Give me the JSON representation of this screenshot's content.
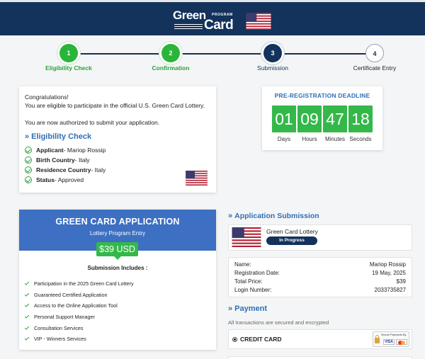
{
  "header": {
    "logo_word1": "Green",
    "logo_program": "PROGRAM",
    "logo_word2": "Card",
    "flag_icon": "us-flag-icon",
    "background_color": "#13325c"
  },
  "steps": [
    {
      "number": "1",
      "label": "Eligibility Check",
      "state": "done"
    },
    {
      "number": "2",
      "label": "Confirmation",
      "state": "done"
    },
    {
      "number": "3",
      "label": "Submission",
      "state": "active"
    },
    {
      "number": "4",
      "label": "Certificate Entry",
      "state": "todo"
    }
  ],
  "congrats": {
    "line1": "Congratulations!",
    "line2": "You are eligible to participate in the official U.S. Green Card Lottery.",
    "line3": "You are now authorized to submit your application.",
    "eligibility_title": "Eligibility Check",
    "rows": [
      {
        "key": "Applicant",
        "value": " - Mariop Rossip"
      },
      {
        "key": "Birth Country",
        "value": " - Italy"
      },
      {
        "key": "Residence Country",
        "value": " - Italy"
      },
      {
        "key": "Status",
        "value": " - Approved"
      }
    ]
  },
  "deadline": {
    "title": "PRE-REGISTRATION DEADLINE",
    "units": [
      {
        "value": "01",
        "label": "Days"
      },
      {
        "value": "09",
        "label": "Hours"
      },
      {
        "value": "47",
        "label": "Minutes"
      },
      {
        "value": "18",
        "label": "Seconds"
      }
    ],
    "accent_color": "#34b84a"
  },
  "application": {
    "title": "GREEN CARD APPLICATION",
    "subtitle": "Lottery Program Entry",
    "price": "$39 USD",
    "includes_title": "Submission Includes :",
    "includes": [
      "Participation in the 2025 Green Card Lottery",
      "Guaranteed Certified Application",
      "Access to the Online Application Tool",
      "Personal Support Manager",
      "Consultation Services",
      "VIP - Winners Services"
    ]
  },
  "submission": {
    "title": "Application Submission",
    "product": "Green Card Lottery",
    "status": "In Progress",
    "details": [
      {
        "label": "Name:",
        "value": "Mariop Rossip"
      },
      {
        "label": "Registration Date:",
        "value": "19 May, 2025"
      },
      {
        "label": "Total Price:",
        "value": "$39"
      },
      {
        "label": "Login Number:",
        "value": "2033735827"
      }
    ]
  },
  "payment": {
    "title": "Payment",
    "subtitle": "All transactions are secured and encrypted",
    "method": "CREDIT CARD",
    "secure_text": "Secure Payments By",
    "card_visa": "VISA"
  }
}
